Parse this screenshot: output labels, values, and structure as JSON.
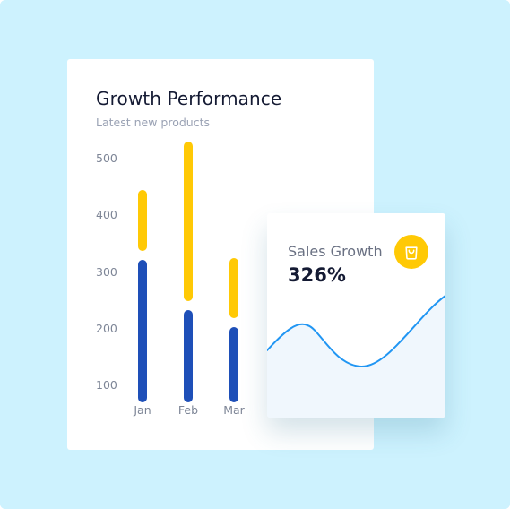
{
  "colors": {
    "background": "#cdf2fe",
    "bar_top": "#ffc905",
    "bar_bottom": "#1e4fb8",
    "line": "#2196f3",
    "line_fill": "#f0f7fd",
    "accent": "#ffc905"
  },
  "growth_card": {
    "title": "Growth Performance",
    "subtitle": "Latest new products"
  },
  "chart_data": {
    "type": "bar",
    "categories": [
      "Jan",
      "Feb",
      "Mar"
    ],
    "y_ticks": [
      "500",
      "400",
      "300",
      "200",
      "100"
    ],
    "ylim": [
      100,
      500
    ],
    "stacked": true,
    "series": [
      {
        "color": "#1e4fb8",
        "values": [
          290,
          200,
          170
        ]
      },
      {
        "color": "#ffc905",
        "values": [
          115,
          290,
          115
        ]
      }
    ]
  },
  "sales_card": {
    "label": "Sales Growth",
    "value": "326%",
    "icon": "shopping-bag-icon"
  }
}
